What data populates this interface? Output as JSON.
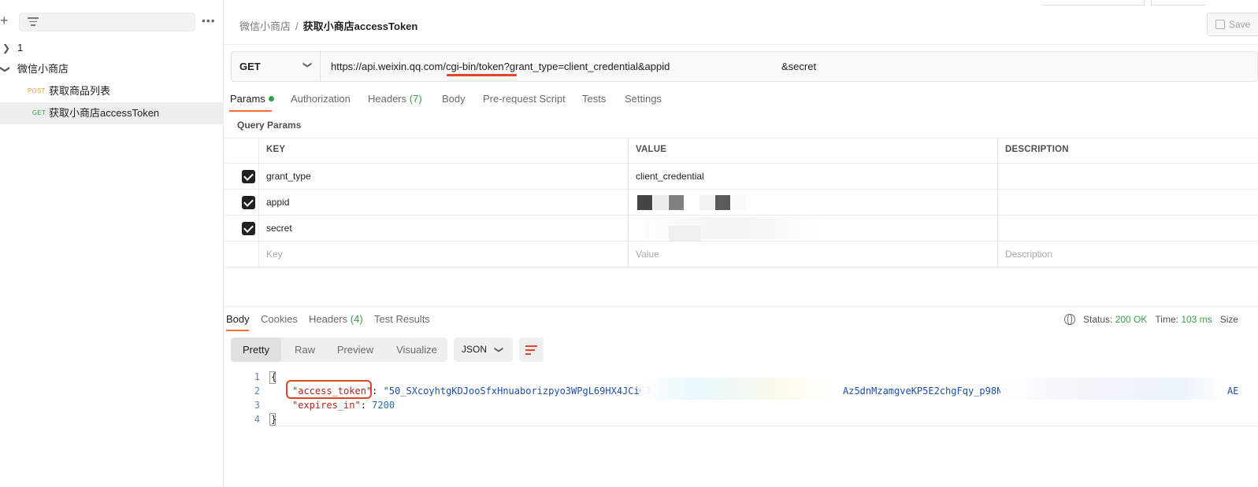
{
  "sidebar": {
    "new_icon": "plus-icon",
    "filter_icon": "filter-icon",
    "more_icon": "more-dots-icon",
    "more_label": "•••",
    "tree": [
      {
        "label": "1",
        "type": "collection",
        "expanded": false
      },
      {
        "label": "微信小商店",
        "type": "collection",
        "expanded": true,
        "requests": [
          {
            "method": "POST",
            "label": "获取商品列表"
          },
          {
            "method": "GET",
            "label": "获取小商店accessToken",
            "active": true
          }
        ]
      }
    ]
  },
  "header": {
    "breadcrumb_parent": "微信小商店",
    "breadcrumb_sep": "/",
    "breadcrumb_current": "获取小商店accessToken",
    "save_label": "Save"
  },
  "request": {
    "method": "GET",
    "url": "https://api.weixin.qq.com/cgi-bin/token?grant_type=client_credential&appid",
    "url_tail": "&secret",
    "tabs": [
      {
        "label": "Params",
        "active": true
      },
      {
        "label": "Authorization"
      },
      {
        "label": "Headers",
        "count": "(7)"
      },
      {
        "label": "Body"
      },
      {
        "label": "Pre-request Script"
      },
      {
        "label": "Tests"
      },
      {
        "label": "Settings"
      }
    ],
    "query_params_title": "Query Params",
    "table": {
      "headers": [
        "KEY",
        "VALUE",
        "DESCRIPTION"
      ],
      "rows": [
        {
          "checked": true,
          "key": "grant_type",
          "value": "client_credential",
          "description": ""
        },
        {
          "checked": true,
          "key": "appid",
          "value": "",
          "description": ""
        },
        {
          "checked": true,
          "key": "secret",
          "value": "",
          "description": ""
        }
      ],
      "placeholder": {
        "key": "Key",
        "value": "Value",
        "description": "Description"
      }
    }
  },
  "response": {
    "tabs": [
      {
        "label": "Body",
        "active": true
      },
      {
        "label": "Cookies"
      },
      {
        "label": "Headers",
        "count": "(4)"
      },
      {
        "label": "Test Results"
      }
    ],
    "status_label": "Status:",
    "status_value": "200 OK",
    "time_label": "Time:",
    "time_value": "103 ms",
    "size_label": "Size",
    "views": [
      "Pretty",
      "Raw",
      "Preview",
      "Visualize"
    ],
    "active_view": "Pretty",
    "format": "JSON",
    "code": {
      "line_numbers": [
        "1",
        "2",
        "3",
        "4"
      ],
      "open_brace": "{",
      "close_brace": "}",
      "access_token_key": "\"access_token\"",
      "access_token_value_start": "\"50_SXcoyhtgKDJooSfxHnuaborizpyo3WPgL69HX4JCi6J",
      "access_token_value_mid": "Az5dnMzamgveKP5E2chgFqy_p98Ng",
      "access_token_value_end": "AE",
      "expires_in_key": "\"expires_in\"",
      "expires_in_value": "7200"
    }
  },
  "colors": {
    "accent": "#ff6c37",
    "annotation_red": "#e2462a",
    "success_green": "#35a04b",
    "post_orange": "#e6a21a"
  }
}
